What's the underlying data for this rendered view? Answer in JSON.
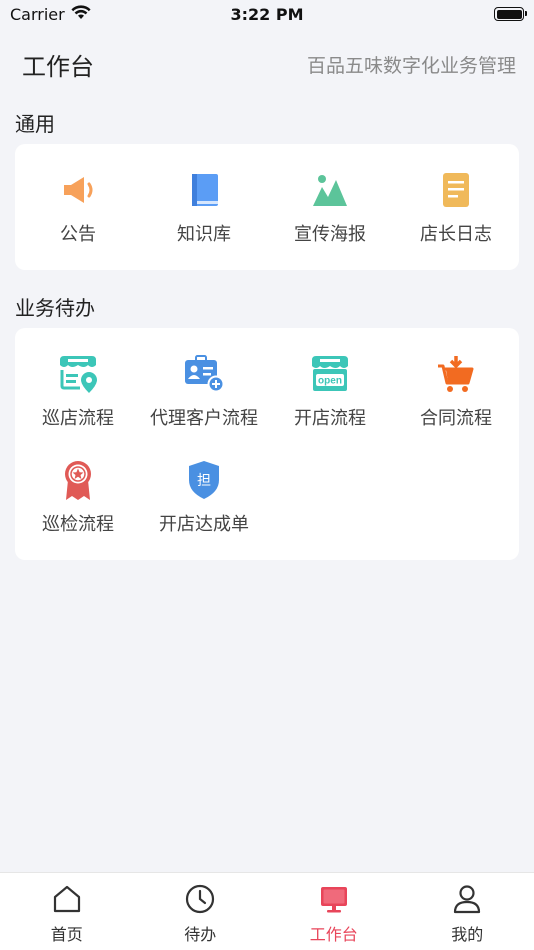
{
  "status": {
    "carrier": "Carrier",
    "time": "3:22 PM"
  },
  "header": {
    "title": "工作台",
    "subtitle": "百品五味数字化业务管理"
  },
  "sections": {
    "general": {
      "title": "通用",
      "items": [
        {
          "label": "公告",
          "icon": "megaphone-icon"
        },
        {
          "label": "知识库",
          "icon": "book-icon"
        },
        {
          "label": "宣传海报",
          "icon": "poster-icon"
        },
        {
          "label": "店长日志",
          "icon": "log-icon"
        }
      ]
    },
    "tasks": {
      "title": "业务待办",
      "items": [
        {
          "label": "巡店流程",
          "icon": "store-location-icon"
        },
        {
          "label": "代理客户流程",
          "icon": "agent-customer-icon"
        },
        {
          "label": "开店流程",
          "icon": "open-store-icon"
        },
        {
          "label": "合同流程",
          "icon": "cart-icon"
        },
        {
          "label": "巡检流程",
          "icon": "award-badge-icon"
        },
        {
          "label": "开店达成单",
          "icon": "shield-icon",
          "badge_text": "担"
        }
      ]
    }
  },
  "tabbar": {
    "items": [
      {
        "label": "首页",
        "icon": "home-icon"
      },
      {
        "label": "待办",
        "icon": "clock-icon"
      },
      {
        "label": "工作台",
        "icon": "monitor-icon"
      },
      {
        "label": "我的",
        "icon": "user-icon"
      }
    ],
    "active_index": 2
  },
  "colors": {
    "accent": "#e8455a",
    "megaphone": "#f7a15a",
    "book": "#5b9df5",
    "poster": "#5cc49a",
    "log": "#f0b95a",
    "teal": "#3cc6b8",
    "blue": "#4a90e2",
    "orange": "#f26b21",
    "red": "#e05a56"
  }
}
